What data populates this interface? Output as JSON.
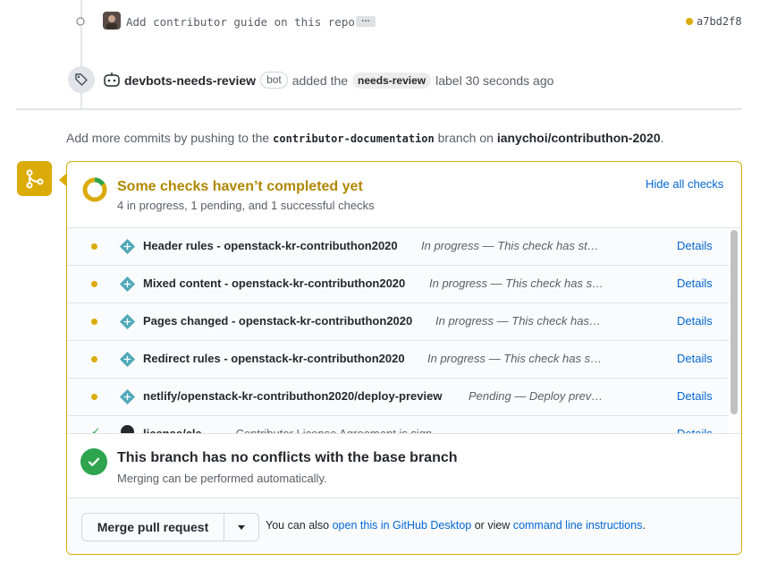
{
  "timeline": {
    "commit": {
      "message": "Add contributor guide on this repo",
      "ellipsis": "…",
      "sha": "a7bd2f8"
    },
    "label_event": {
      "actor": "devbots-needs-review",
      "bot_badge": "bot",
      "verb": "added the",
      "label": "needs-review",
      "suffix": "label 30 seconds ago"
    }
  },
  "push_note": {
    "prefix": "Add more commits by pushing to the",
    "branch": "contributor-documentation",
    "middle": "branch on",
    "repo": "ianychoi/contributhon-2020",
    "suffix": "."
  },
  "checks": {
    "title": "Some checks haven’t completed yet",
    "subtitle": "4 in progress, 1 pending, and 1 successful checks",
    "hide_link": "Hide all checks",
    "items": [
      {
        "name": "Header rules - openstack-kr-contributhon2020",
        "desc": "In progress — This check has st…",
        "details": "Details"
      },
      {
        "name": "Mixed content - openstack-kr-contributhon2020",
        "desc": "In progress — This check has s…",
        "details": "Details"
      },
      {
        "name": "Pages changed - openstack-kr-contributhon2020",
        "desc": "In progress — This check has…",
        "details": "Details"
      },
      {
        "name": "Redirect rules - openstack-kr-contributhon2020",
        "desc": "In progress — This check has s…",
        "details": "Details"
      },
      {
        "name": "netlify/openstack-kr-contributhon2020/deploy-preview",
        "desc": "Pending — Deploy prev…",
        "details": "Details"
      },
      {
        "name": "license/cla",
        "desc": "— Contributor License Agreement is signed.",
        "details": "Details"
      }
    ]
  },
  "conflicts": {
    "title": "This branch has no conflicts with the base branch",
    "subtitle": "Merging can be performed automatically."
  },
  "merge": {
    "button_label": "Merge pull request",
    "text_prefix": "You can also",
    "desktop_link": "open this in GitHub Desktop",
    "text_middle": "or view",
    "cli_link": "command line instructions",
    "text_suffix": "."
  },
  "colors": {
    "pending": "#dbab09",
    "success": "#2ea44f",
    "link": "#0366d6"
  }
}
